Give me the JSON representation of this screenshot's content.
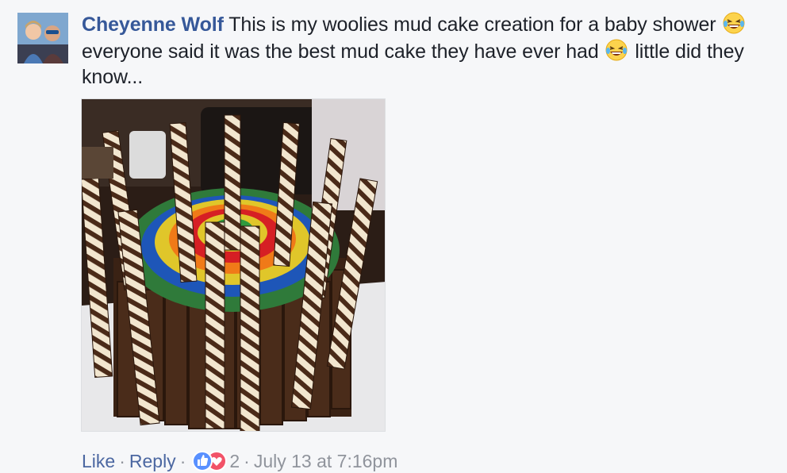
{
  "comment": {
    "author": "Cheyenne Wolf",
    "text_part1": " This is my woolies mud cake creation for a baby shower ",
    "text_part2": " everyone said it was the best mud cake they have ever had ",
    "text_part3": " little did they know...",
    "emoji": "laughing-tears-emoji"
  },
  "actions": {
    "like_label": "Like",
    "reply_label": "Reply",
    "reaction_count": "2",
    "timestamp": "July 13 at 7:16pm",
    "separator": "·"
  },
  "colors": {
    "link": "#365899",
    "meta": "#90949c",
    "like_blue": "#5890ff",
    "love_red": "#f25268",
    "background": "#f6f7f9"
  }
}
